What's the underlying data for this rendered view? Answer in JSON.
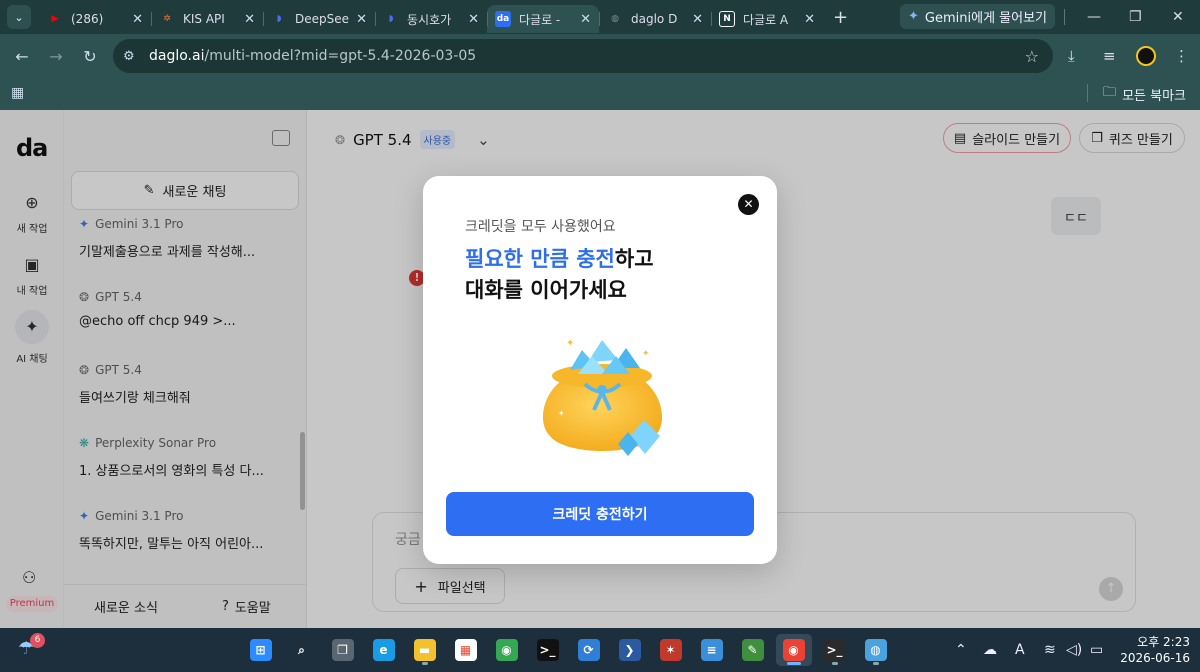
{
  "browser": {
    "tabs": [
      {
        "title": "(286)",
        "icon": "youtube-icon",
        "color": "#ff0000",
        "glyph": "▶"
      },
      {
        "title": "KIS API",
        "icon": "kis-icon",
        "color": "#e8743b",
        "glyph": "✲"
      },
      {
        "title": "DeepSee",
        "icon": "deepseek-icon",
        "color": "#4d6bfe",
        "glyph": "◗"
      },
      {
        "title": "동시호가",
        "icon": "deepseek-icon",
        "color": "#4d6bfe",
        "glyph": "◗"
      },
      {
        "title": "다글로 -",
        "icon": "daglo-icon",
        "color": "#2d6ef2",
        "glyph": "da"
      },
      {
        "title": "daglo D",
        "icon": "globe-icon",
        "color": "#7d8f8f",
        "glyph": "◍"
      },
      {
        "title": "다글로 A",
        "icon": "notion-icon",
        "color": "#ffffff",
        "glyph": "N"
      }
    ],
    "active_tab": 4,
    "new_tab_label": "+",
    "gemini_label": "Gemini에게 물어보기",
    "url_host": "daglo.ai",
    "url_path": "/multi-model?mid=gpt-5.4-2026-03-05",
    "bookmarks_label": "모든 북마크"
  },
  "app": {
    "logo": "da",
    "rail": [
      {
        "label": "새 작업",
        "icon": "plus-circle-icon",
        "glyph": "⊕"
      },
      {
        "label": "내 작업",
        "icon": "archive-icon",
        "glyph": "▣"
      },
      {
        "label": "AI 채팅",
        "icon": "ai-chat-icon",
        "glyph": "✦"
      }
    ],
    "premium_label": "Premium",
    "new_chat_label": "새로운 채팅",
    "chats": [
      {
        "model": "Gemini 3.1 Pro",
        "kind": "gem",
        "snippet": "기말제출용으로 과제를 작성해..."
      },
      {
        "model": "GPT 5.4",
        "kind": "gpt",
        "snippet": "@echo off chcp 949 >..."
      },
      {
        "model": "GPT 5.4",
        "kind": "gpt",
        "snippet": "들여쓰기랑 체크해줘"
      },
      {
        "model": "Perplexity Sonar Pro",
        "kind": "ppx",
        "snippet": "1. 상품으로서의 영화의 특성 다..."
      },
      {
        "model": "Gemini 3.1 Pro",
        "kind": "gem",
        "snippet": "똑똑하지만, 말투는 아직 어린아..."
      }
    ],
    "footer": {
      "news_label": "새로운 소식",
      "help_label": "도움말"
    },
    "model_name": "GPT 5.4",
    "model_badge": "사용중",
    "slide_label": "슬라이드 만들기",
    "quiz_label": "퀴즈 만들기",
    "user_message": "ㄷㄷ",
    "error_mark": "!",
    "composer_placeholder": "궁금",
    "file_label": "파일선택"
  },
  "modal": {
    "subtitle": "크레딧을 모두 사용했어요",
    "title_highlight": "필요한 만큼 충전",
    "title_rest": "하고",
    "title_line2": "대화를 이어가세요",
    "cta_label": "크레딧 충전하기"
  },
  "taskbar": {
    "weather_badge": "6",
    "apps": [
      {
        "name": "windows-start-icon",
        "glyph": "⊞",
        "bg": "#2b8cff",
        "running": false
      },
      {
        "name": "search-icon",
        "glyph": "⌕",
        "bg": "transparent",
        "running": false
      },
      {
        "name": "task-view-icon",
        "glyph": "❐",
        "bg": "#5a6672",
        "running": false
      },
      {
        "name": "edge-icon",
        "glyph": "e",
        "bg": "#1a9be6",
        "running": false
      },
      {
        "name": "file-explorer-icon",
        "glyph": "▬",
        "bg": "#f2c12e",
        "running": true
      },
      {
        "name": "microsoft-store-icon",
        "glyph": "▦",
        "bg": "#ffffff",
        "running": false
      },
      {
        "name": "chrome-icon",
        "glyph": "◉",
        "bg": "#34a853",
        "running": false
      },
      {
        "name": "terminal-icon",
        "glyph": ">_",
        "bg": "#111111",
        "running": false
      },
      {
        "name": "sync-app-icon",
        "glyph": "⟳",
        "bg": "#2f7fd6",
        "running": false
      },
      {
        "name": "powershell-icon",
        "glyph": "❯",
        "bg": "#2c5aa0",
        "running": false
      },
      {
        "name": "game-app-icon",
        "glyph": "✶",
        "bg": "#c0392b",
        "running": false
      },
      {
        "name": "notepad-icon",
        "glyph": "≡",
        "bg": "#3b8fd8",
        "running": false
      },
      {
        "name": "paint-icon",
        "glyph": "✎",
        "bg": "#3f8f3f",
        "running": false
      },
      {
        "name": "chrome-profile-icon",
        "glyph": "◉",
        "bg": "#ea4335",
        "running": true
      },
      {
        "name": "cmd-icon",
        "glyph": ">_",
        "bg": "#2b2b2b",
        "running": true
      },
      {
        "name": "browser-globe-icon",
        "glyph": "◍",
        "bg": "#4aa3df",
        "running": true
      }
    ],
    "active_app": 13,
    "ime_label": "A",
    "time": "오후 2:23",
    "date": "2026-06-16"
  }
}
